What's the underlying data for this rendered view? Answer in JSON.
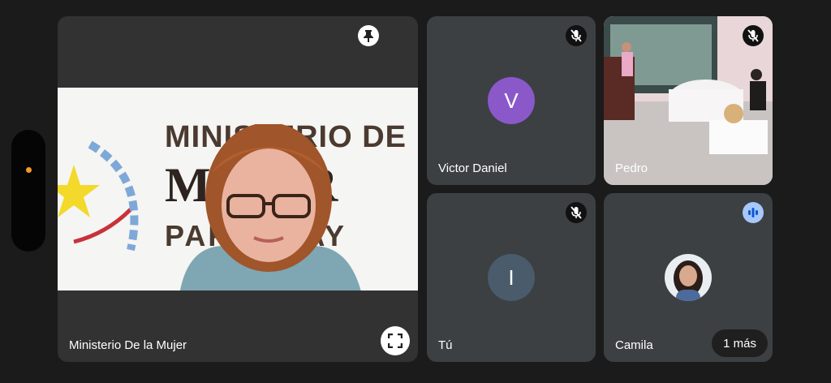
{
  "colors": {
    "background": "#1b1b1b",
    "tile": "#3c4043",
    "avatar_victor": "#8b58c9",
    "avatar_you": "#4a5b6b",
    "speaking_indicator": "#a8c7fa",
    "side_dot": "#f29a2e"
  },
  "tiles": {
    "main": {
      "name": "Ministerio De la Mujer",
      "logo_lines": [
        "MINISTERIO DE",
        "MUJER",
        "PARAGUAY"
      ],
      "pin_icon": "pin-icon",
      "fullscreen_icon": "fullscreen-icon"
    },
    "victor": {
      "name": "Victor Daniel",
      "initial": "V",
      "status_icon": "mic-off-icon"
    },
    "pedro": {
      "name": "Pedro",
      "status_icon": "mic-off-icon"
    },
    "you": {
      "name": "Tú",
      "initial": "I",
      "status_icon": "mic-off-icon"
    },
    "camila": {
      "name": "Camila",
      "status_icon": "speaking-icon",
      "more_label": "1 más"
    }
  }
}
